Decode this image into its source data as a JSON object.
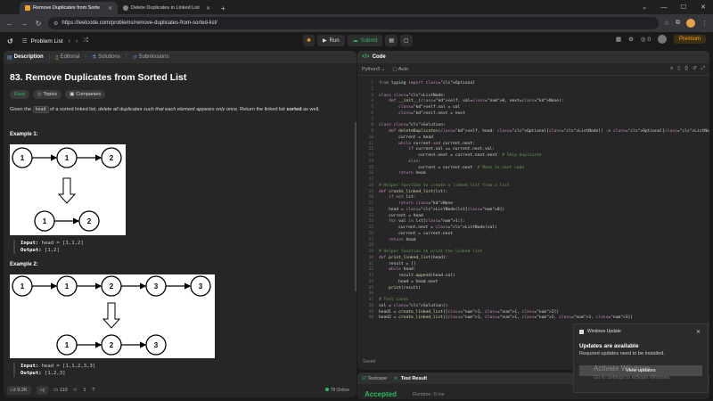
{
  "browser": {
    "tabs": [
      {
        "label": "Remove Duplicates from Sorte",
        "active": true
      },
      {
        "label": "Delete Duplicates in Linked List",
        "active": false
      }
    ],
    "url": "https://leetcode.com/problems/remove-duplicates-from-sorted-list/"
  },
  "lcnav": {
    "problem_list": "Problem List",
    "run": "Run",
    "submit": "Submit",
    "streak": "0",
    "premium": "Premium"
  },
  "left": {
    "tabs": [
      "Description",
      "Editorial",
      "Solutions",
      "Submissions"
    ],
    "title": "83. Remove Duplicates from Sorted List",
    "badges": [
      "Easy",
      "Topics",
      "Companies"
    ],
    "desc_pre": "Given the",
    "desc_code": "head",
    "desc_mid": "of a sorted linked list,",
    "desc_em": "delete all duplicates such that each element appears only once",
    "desc_post": ". Return the linked list",
    "desc_strong": "sorted",
    "desc_end": "as well.",
    "example1": {
      "label": "Example 1:",
      "top_nodes": [
        "1",
        "1",
        "2"
      ],
      "bottom_nodes": [
        "1",
        "2"
      ],
      "input_label": "Input:",
      "input": "head = [1,1,2]",
      "output_label": "Output:",
      "output": "[1,2]"
    },
    "example2": {
      "label": "Example 2:",
      "top_nodes": [
        "1",
        "1",
        "2",
        "3",
        "3"
      ],
      "bottom_nodes": [
        "1",
        "2",
        "3"
      ],
      "input_label": "Input:",
      "input": "head = [1,1,2,3,3]",
      "output_label": "Output:",
      "output": "[1,2,3]"
    },
    "footer": {
      "likes": "9.2K",
      "comments": "110",
      "online": "78 Online"
    }
  },
  "code": {
    "header": "Code",
    "language": "Python3",
    "mode": "Auto",
    "saved": "Saved",
    "lines": [
      "from typing import Optional",
      "",
      "class ListNode:",
      "    def __init__(self, val=0, next=None):",
      "        self.val = val",
      "        self.next = next",
      "",
      "class Solution:",
      "    def deleteDuplicates(self, head: Optional[ListNode]) -> Optional[ListNode]:",
      "        current = head",
      "        while current and current.next:",
      "            if current.val == current.next.val:",
      "                current.next = current.next.next  # Skip duplicate",
      "            else:",
      "                current = current.next  # Move to next node",
      "        return head",
      "",
      "# Helper function to create a linked list from a list",
      "def create_linked_list(lst):",
      "    if not lst:",
      "        return None",
      "    head = ListNode(lst[0])",
      "    current = head",
      "    for val in lst[1:]:",
      "        current.next = ListNode(val)",
      "        current = current.next",
      "    return head",
      "",
      "# Helper function to print the linked list",
      "def print_linked_list(head):",
      "    result = []",
      "    while head:",
      "        result.append(head.val)",
      "        head = head.next",
      "    print(result)",
      "",
      "# Test cases",
      "sol = Solution()",
      "head1 = create_linked_list([1, 1, 2])",
      "head2 = create_linked_list([1, 1, 2, 3, 3])"
    ]
  },
  "test": {
    "tabs": [
      "Testcase",
      "Test Result"
    ],
    "status": "Accepted",
    "runtime": "Runtime: 0 ms"
  },
  "toast": {
    "app": "Windows Update",
    "title": "Updates are available",
    "body": "Required updates need to be installed.",
    "button": "View updates",
    "watermark": "Activate Windows",
    "watermark_sub": "Go to Settings to activate Windows."
  }
}
